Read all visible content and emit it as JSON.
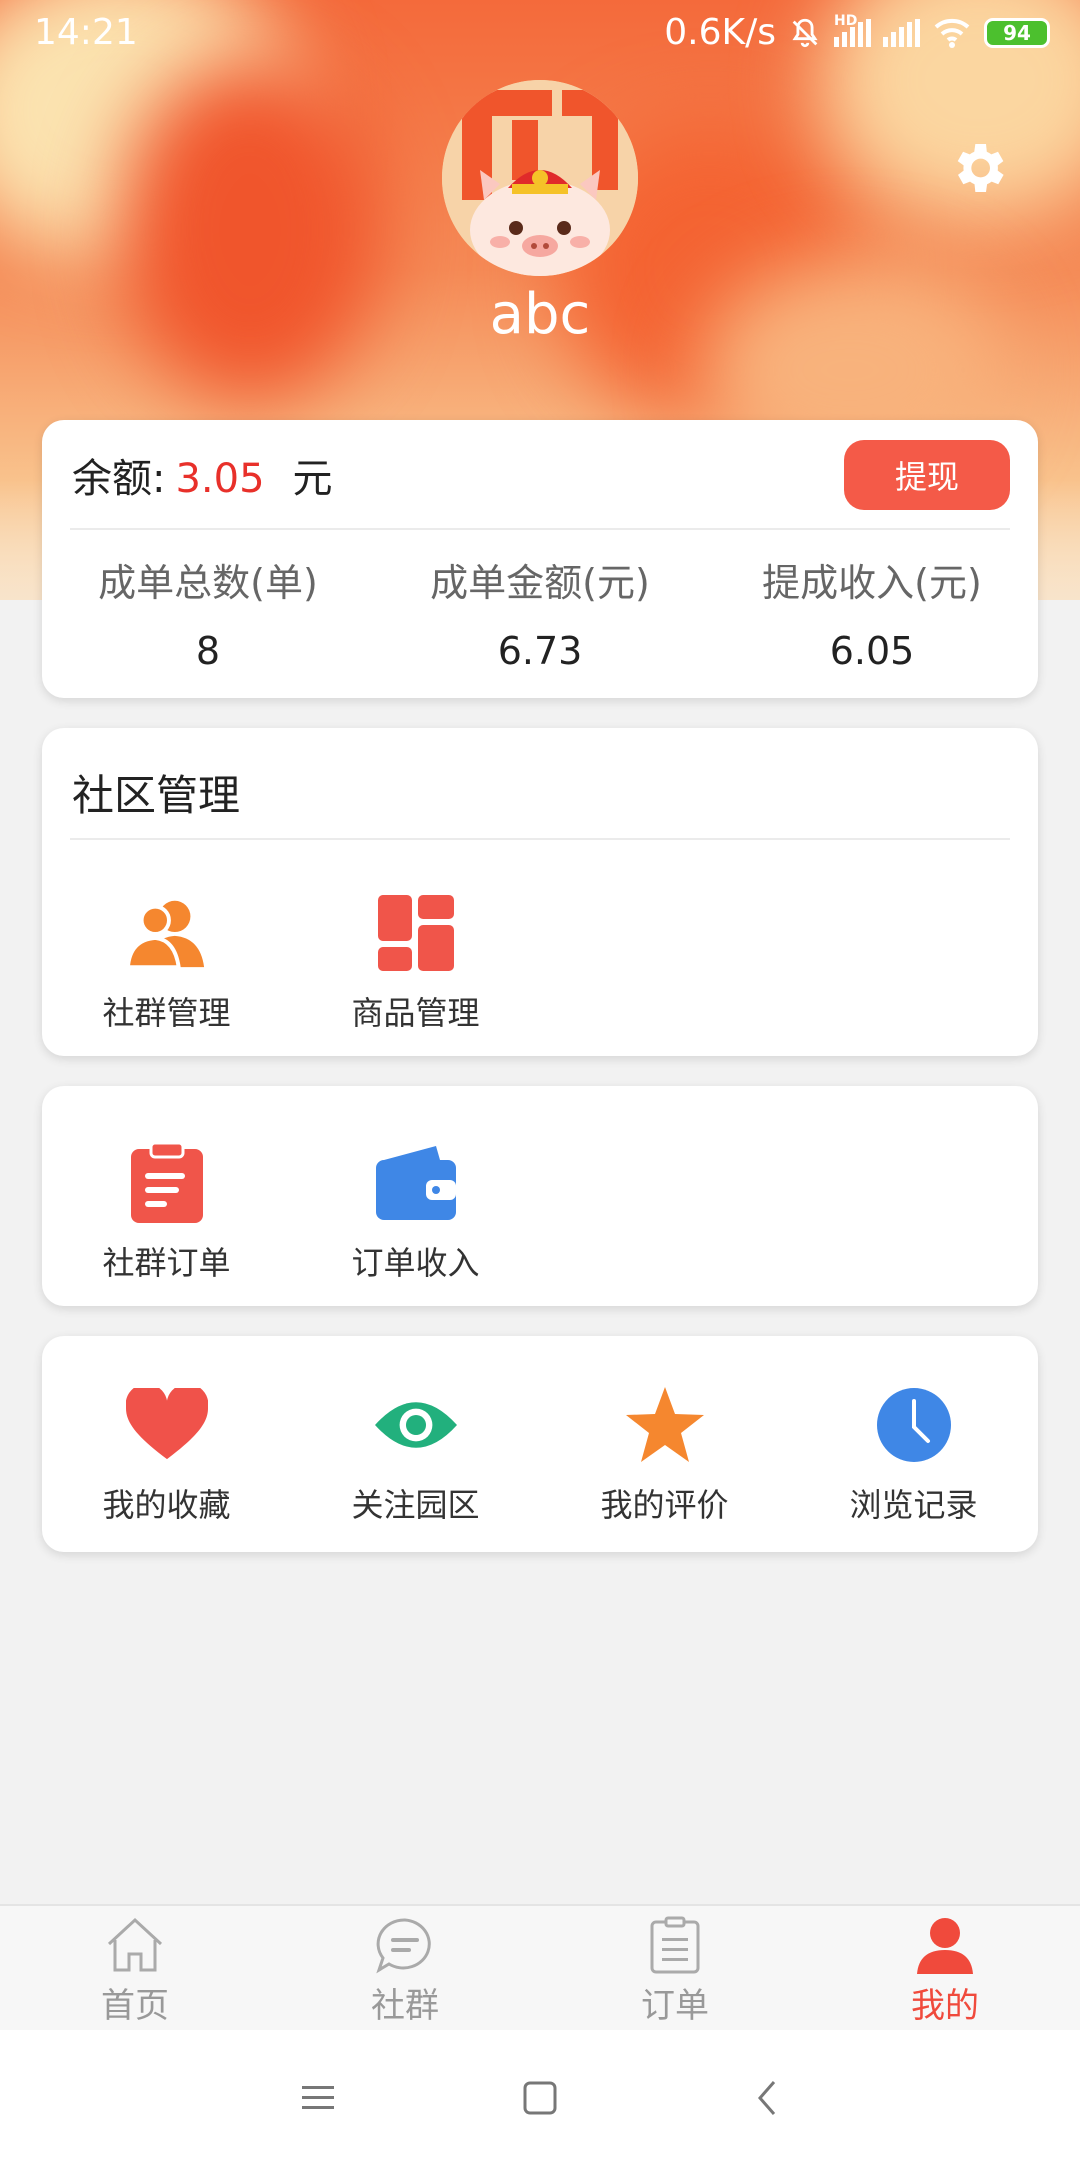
{
  "status_bar": {
    "time": "14:21",
    "speed": "0.6K/s",
    "network_badge": "HD",
    "battery": "94"
  },
  "profile": {
    "username": "abc",
    "avatar_icon": "pig-avatar-icon"
  },
  "balance": {
    "label": "余额:",
    "amount": "3.05",
    "unit": "元",
    "withdraw_label": "提现",
    "stats": [
      {
        "label": "成单总数(单)",
        "value": "8"
      },
      {
        "label": "成单金额(元)",
        "value": "6.73"
      },
      {
        "label": "提成收入(元)",
        "value": "6.05"
      }
    ]
  },
  "community": {
    "title": "社区管理",
    "items": [
      {
        "label": "社群管理",
        "icon": "users-icon"
      },
      {
        "label": "商品管理",
        "icon": "grid-icon"
      }
    ]
  },
  "orders": {
    "items": [
      {
        "label": "社群订单",
        "icon": "clipboard-icon"
      },
      {
        "label": "订单收入",
        "icon": "wallet-icon"
      }
    ]
  },
  "misc": {
    "items": [
      {
        "label": "我的收藏",
        "icon": "heart-icon"
      },
      {
        "label": "关注园区",
        "icon": "eye-icon"
      },
      {
        "label": "我的评价",
        "icon": "star-icon"
      },
      {
        "label": "浏览记录",
        "icon": "clock-icon"
      }
    ]
  },
  "tabbar": {
    "items": [
      {
        "label": "首页",
        "icon": "home-icon"
      },
      {
        "label": "社群",
        "icon": "chat-icon"
      },
      {
        "label": "订单",
        "icon": "order-icon"
      },
      {
        "label": "我的",
        "icon": "person-icon"
      }
    ],
    "active": "我的"
  },
  "colors": {
    "accent": "#f45a48",
    "amount": "#e8302a",
    "users": "#f5872f",
    "grid": "#f0554a",
    "clipboard": "#f0554a",
    "wallet": "#3f87e6",
    "heart": "#f0524a",
    "eye": "#22b07d",
    "star": "#f5872f",
    "clock": "#3f87e6"
  }
}
